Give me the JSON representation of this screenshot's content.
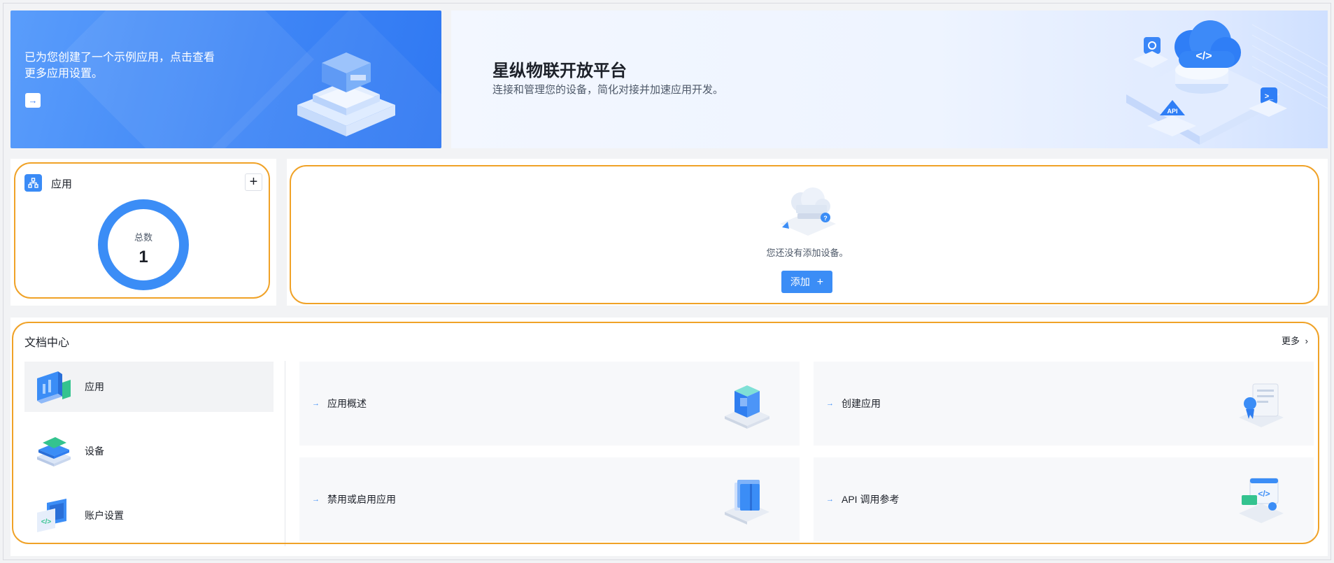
{
  "banner_left": {
    "message": "已为您创建了一个示例应用，点击查看更多应用设置。",
    "arrow": "→"
  },
  "banner_right": {
    "title": "星纵物联开放平台",
    "subtitle": "连接和管理您的设备，简化对接并加速应用开发。",
    "badges": [
      "API"
    ]
  },
  "app_card": {
    "title": "应用",
    "plus": "+",
    "total_label": "总数",
    "total_value": "1"
  },
  "device_card": {
    "empty_text": "您还没有添加设备。",
    "add_label": "添加",
    "add_icon": "+"
  },
  "docs": {
    "title": "文档中心",
    "more_label": "更多",
    "more_icon": "›",
    "categories": [
      {
        "label": "应用",
        "icon": "app-monitor-icon"
      },
      {
        "label": "设备",
        "icon": "device-stack-icon"
      },
      {
        "label": "账户设置",
        "icon": "account-code-icon"
      }
    ],
    "tiles": [
      {
        "label": "应用概述",
        "icon": "cube-icon"
      },
      {
        "label": "创建应用",
        "icon": "certificate-icon"
      },
      {
        "label": "禁用或启用应用",
        "icon": "folder-icon"
      },
      {
        "label": "API 调用参考",
        "icon": "code-window-icon"
      }
    ],
    "tile_arrow": "→"
  },
  "colors": {
    "accent": "#3b8df6",
    "highlight": "#f0a227"
  }
}
